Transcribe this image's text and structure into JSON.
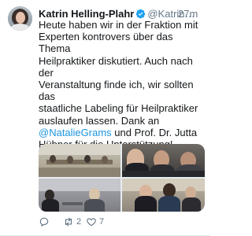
{
  "tweet": {
    "author_name": "Katrin Helling-Plahr",
    "handle": "@Katrin…",
    "time": "27m",
    "text_lines": [
      "Heute haben wir in der Fraktion mit",
      "Experten kontrovers über das Thema",
      "Heilpraktiker diskutiert. Auch nach der",
      "Veranstaltung finde ich, wir sollten das",
      "staatliche Labeling für Heilpraktiker",
      "auslaufen lassen. Dank an"
    ],
    "mention": "@NatalieGrams",
    "text_after_mention": " und Prof. Dr. Jutta",
    "text_line_last": "Hübner für die Unterstützung!",
    "reply_count": "",
    "retweet_count": "2",
    "like_count": "7",
    "colors": {
      "link": "#1b95e0",
      "secondary_text": "#657786",
      "verified": "#1da1f2"
    },
    "icons": [
      "verified-badge-icon",
      "reply-icon",
      "retweet-icon",
      "like-icon"
    ]
  }
}
